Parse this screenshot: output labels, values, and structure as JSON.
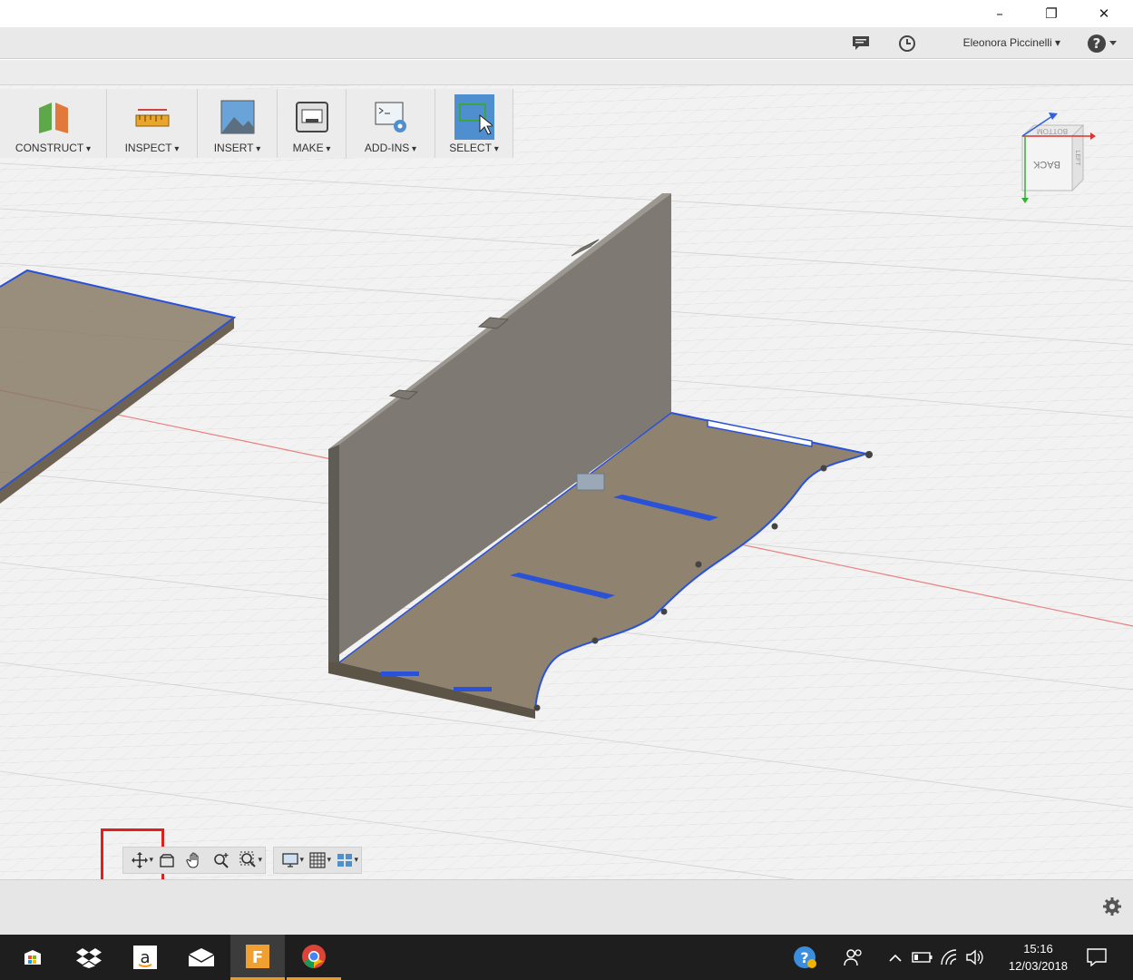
{
  "window": {
    "minimize_icon": "minimize-icon",
    "restore_icon": "restore-icon",
    "close_icon": "close-icon"
  },
  "header": {
    "user_name": "Eleonora Piccinelli ▾",
    "icons": [
      "comment-icon",
      "history-clock-icon",
      "help-icon"
    ],
    "help_label": "?▾"
  },
  "toolbar": {
    "groups": [
      {
        "label": "CONSTRUCT",
        "icon": "construct-plane-icon"
      },
      {
        "label": "INSPECT",
        "icon": "ruler-icon"
      },
      {
        "label": "INSERT",
        "icon": "image-mountain-icon"
      },
      {
        "label": "MAKE",
        "icon": "3d-printer-icon"
      },
      {
        "label": "ADD-INS",
        "icon": "script-gear-icon"
      },
      {
        "label": "SELECT",
        "icon": "select-cursor-icon",
        "active": true
      }
    ]
  },
  "viewcube": {
    "face_label": "BACK",
    "top_label": "BOTTOM",
    "side_label": "LEFT",
    "axis_colors": {
      "x": "#e03030",
      "y": "#30b030",
      "z": "#3060e0"
    }
  },
  "navbar": {
    "tools": [
      {
        "name": "orbit",
        "icon": "orbit-icon"
      },
      {
        "name": "look-at",
        "icon": "look-at-icon"
      },
      {
        "name": "pan",
        "icon": "pan-hand-icon"
      },
      {
        "name": "zoom",
        "icon": "zoom-icon"
      },
      {
        "name": "fit",
        "icon": "zoom-window-icon"
      },
      {
        "name": "display",
        "icon": "display-settings-icon"
      },
      {
        "name": "grid",
        "icon": "grid-settings-icon"
      },
      {
        "name": "viewports",
        "icon": "viewports-icon"
      }
    ]
  },
  "colors": {
    "panel_fill": "#8a7b66",
    "wall_fill": "#7e7a73",
    "edge_blue": "#2a52d8",
    "selection_accent": "#4f8fcf",
    "highlight_red": "#e0201c"
  },
  "taskbar": {
    "apps": [
      "windows-start-icon",
      "dropbox-icon",
      "amazon-icon",
      "mail-icon",
      "fusion360-icon",
      "chrome-icon"
    ],
    "clock_time": "15:16",
    "clock_date": "12/03/2018"
  }
}
